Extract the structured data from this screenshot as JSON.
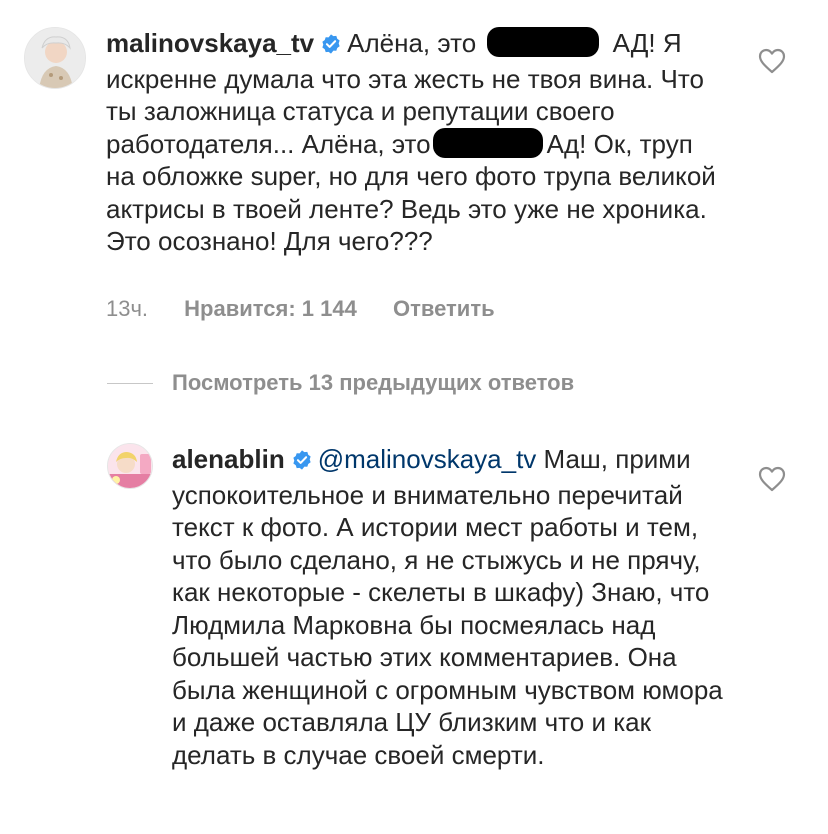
{
  "comment": {
    "username": "malinovskaya_tv",
    "text_part1": "Алёна, это ",
    "redacted_1": "[redacted]",
    "text_part2": " АД! Я искренне думала что  эта жесть не твоя вина. Что ты заложница статуса и репутации своего работодателя... Алёна, это",
    "redacted_2": "[redacted]",
    "text_part3": "Ад! Ок, труп на обложке super, но для чего фото трупа великой актрисы в твоей ленте? Ведь это уже не хроника. Это осознано! Для чего???",
    "time": "13ч.",
    "likes_label": "Нравится: 1 144",
    "reply_label": "Ответить",
    "avatar_icon": "user-avatar-icon",
    "like_icon": "heart-outline-icon"
  },
  "view_replies": {
    "label": "Посмотреть 13 предыдущих ответов"
  },
  "reply": {
    "username": "alenablin",
    "mention": "@malinovskaya_tv",
    "text": " Маш, прими успокоительное и внимательно перечитай текст к фото. А истории мест работы и тем, что было сделано, я не стыжусь и не прячу, как некоторые - скелеты в шкафу) Знаю, что Людмила Марковна бы посмеялась над большей частью этих комментариев. Она была женщиной с огромным чувством юмора и даже оставляла ЦУ близким что и как делать в случае своей смерти.",
    "avatar_icon": "user-avatar-icon",
    "like_icon": "heart-outline-icon"
  },
  "colors": {
    "text": "#262626",
    "secondary": "#8e8e8e",
    "mention": "#00376b",
    "verified": "#3897f0",
    "background": "#ffffff"
  }
}
